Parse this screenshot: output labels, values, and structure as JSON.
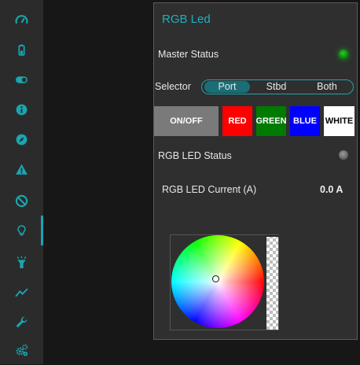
{
  "sidebar": {
    "items": [
      {
        "icon": "gauge-icon"
      },
      {
        "icon": "battery-icon"
      },
      {
        "icon": "toggle-icon"
      },
      {
        "icon": "info-icon"
      },
      {
        "icon": "compass-icon"
      },
      {
        "icon": "warning-icon"
      },
      {
        "icon": "prohibited-icon"
      },
      {
        "icon": "lightbulb-icon",
        "active": true
      },
      {
        "icon": "flashlight-icon"
      },
      {
        "icon": "trend-chart-icon"
      },
      {
        "icon": "wrench-icon"
      },
      {
        "icon": "gears-icon"
      }
    ],
    "icon_color": "#1aa6b0"
  },
  "panel": {
    "title": "RGB Led",
    "master_status": {
      "label": "Master Status",
      "state": "on"
    },
    "selector": {
      "label": "Selector",
      "options": [
        "Port",
        "Stbd",
        "Both"
      ],
      "selected": "Port"
    },
    "color_buttons": [
      {
        "label": "ON/OFF",
        "bg": "#7a7a7a",
        "fg": "#ffffff"
      },
      {
        "label": "RED",
        "bg": "#ff0000",
        "fg": "#ffffff"
      },
      {
        "label": "GREEN",
        "bg": "#007a00",
        "fg": "#ffffff"
      },
      {
        "label": "BLUE",
        "bg": "#0000ff",
        "fg": "#ffffff"
      },
      {
        "label": "WHITE",
        "bg": "#ffffff",
        "fg": "#000000"
      }
    ],
    "rgb_led_status": {
      "label": "RGB LED Status",
      "state": "off"
    },
    "rgb_led_current": {
      "label": "RGB LED Current (A)",
      "value": "0.0 A"
    }
  },
  "colors": {
    "accent": "#1aa6b0",
    "led_on": "#16a616",
    "led_off": "#7c7c7c"
  }
}
